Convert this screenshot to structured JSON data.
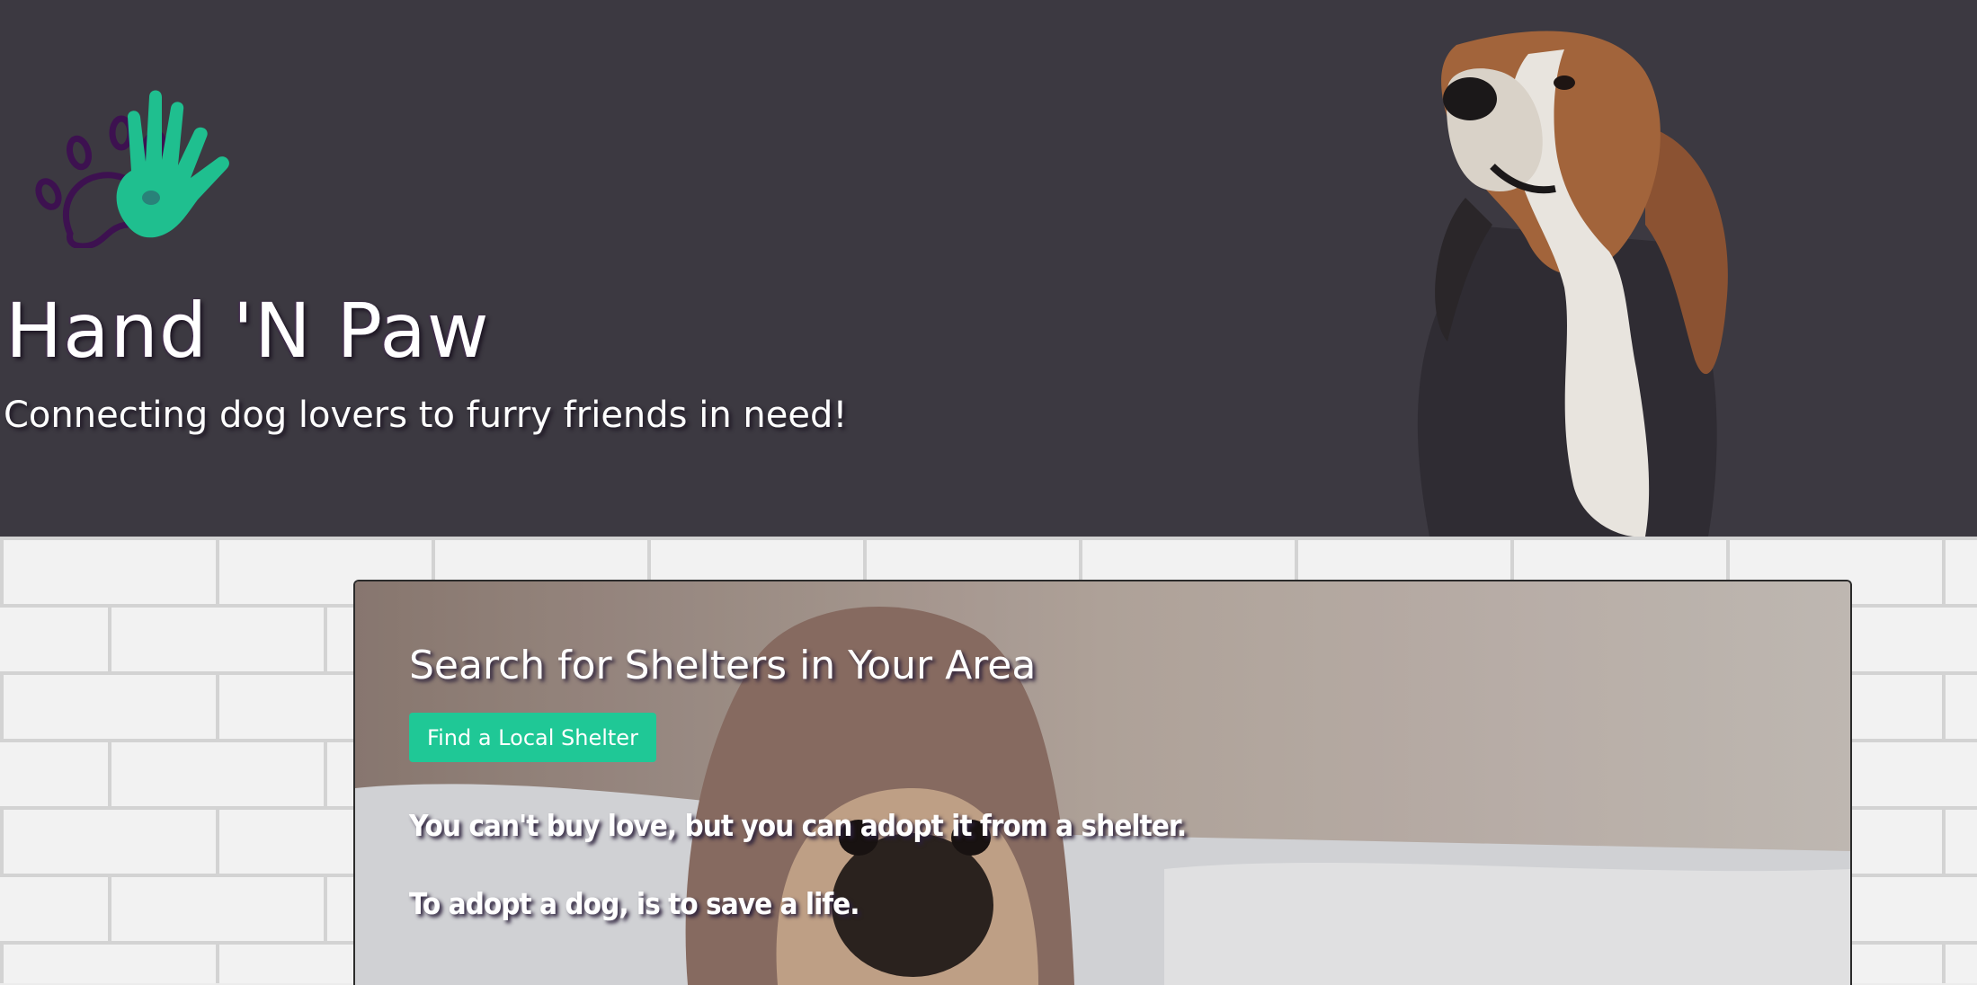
{
  "header": {
    "title": "Hand 'N Paw",
    "tagline": "Connecting dog lovers to furry friends in need!",
    "logo_icon": "hand-and-paw-logo-icon",
    "hero_image": "beagle-photo",
    "background_color": "#3c3941"
  },
  "main": {
    "background_image": "white-brick-wall",
    "card": {
      "background_image": "pug-in-blanket-photo",
      "title": "Search for Shelters in Your Area",
      "button_label": "Find a Local Shelter",
      "quotes": [
        "You can't buy love, but you can adopt it from a shelter.",
        "To adopt a dog, is to save a life."
      ]
    }
  },
  "colors": {
    "accent": "#1fc896",
    "logo_purple": "#3d1150",
    "logo_green": "#1fbf8f"
  }
}
